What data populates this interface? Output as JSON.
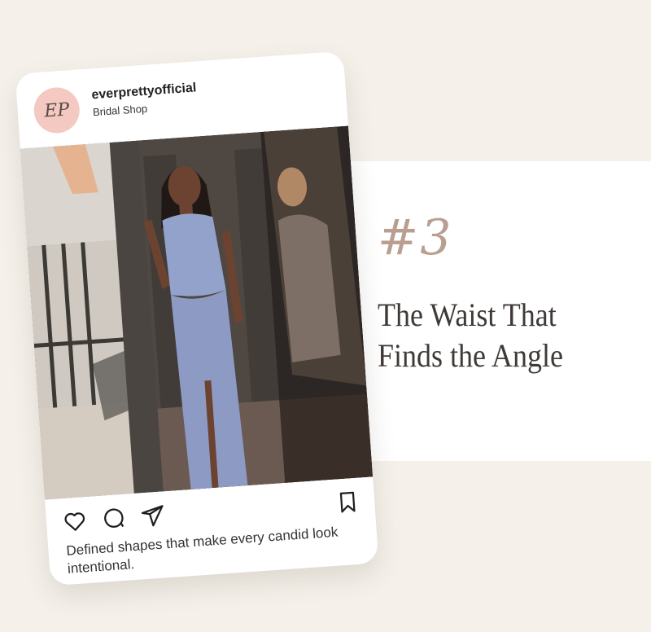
{
  "feature": {
    "number": "#3",
    "headline_line1": "The Waist That",
    "headline_line2": "Finds the Angle"
  },
  "post": {
    "avatar_monogram": "EP",
    "username": "everprettyofficial",
    "account_type": "Bridal Shop",
    "caption": "Defined shapes that make every candid look intentional."
  },
  "icons": {
    "like": "heart-icon",
    "comment": "comment-icon",
    "share": "send-icon",
    "save": "bookmark-icon"
  },
  "colors": {
    "background": "#f5f1ea",
    "panel": "#ffffff",
    "accent_number": "#b89f8f",
    "headline": "#3f3a37",
    "avatar_bg": "#f3c9c1",
    "dress": "#8d9bc4"
  }
}
